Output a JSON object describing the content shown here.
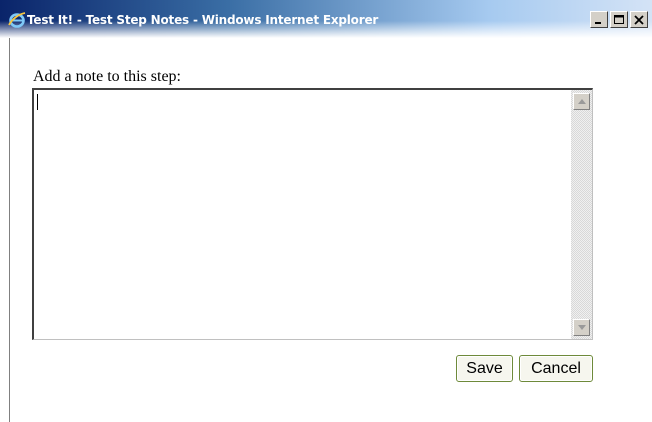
{
  "window": {
    "title": "Test It! - Test Step Notes - Windows Internet Explorer",
    "colors": {
      "titlebar_start": "#0a246a",
      "titlebar_end": "#d4e3f6",
      "button_border": "#6e8a3a"
    }
  },
  "icons": {
    "app": "internet-explorer-icon",
    "minimize": "minimize-icon",
    "maximize": "maximize-icon",
    "close": "close-icon",
    "scroll_up": "scroll-up-arrow-icon",
    "scroll_down": "scroll-down-arrow-icon"
  },
  "form": {
    "label": "Add a note to this step:",
    "note_value": ""
  },
  "buttons": {
    "save": "Save",
    "cancel": "Cancel"
  }
}
